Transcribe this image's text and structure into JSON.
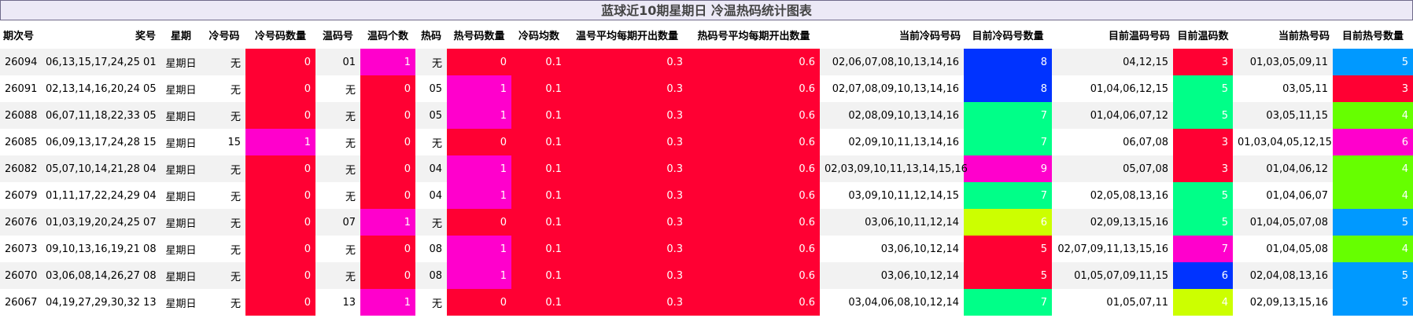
{
  "title": "蓝球近10期星期日 冷温热码统计图表",
  "colors": {
    "red": "#ff0033",
    "magenta": "#ff00cc",
    "blue": "#0033ff",
    "green": "#00ff88",
    "lime": "#ccff00",
    "brightgreen": "#66ff00",
    "skyblue": "#0099ff"
  },
  "headers": [
    "期次号",
    "奖号",
    "星期",
    "冷号码",
    "冷号码数量",
    "温码号",
    "温码个数",
    "热码",
    "热号码数量",
    "冷码均数",
    "温号平均每期开出数量",
    "热码号平均每期开出数量",
    "当前冷码号码",
    "目前冷码号数量",
    "目前温码号码",
    "目前温码数",
    "当前热号码",
    "目前热号数量"
  ],
  "rows": [
    {
      "issue": "26094",
      "balls": "06,13,15,17,24,25 01",
      "weekday": "星期日",
      "cold_no": "无",
      "cold_cnt": "0",
      "cold_cnt_color": "red",
      "warm_no": "01",
      "warm_cnt": "1",
      "warm_cnt_color": "magenta",
      "hot_no": "无",
      "hot_cnt": "0",
      "hot_cnt_color": "red",
      "cold_avg": "0.1",
      "warm_avg": "0.3",
      "hot_avg": "0.6",
      "cur_cold": "02,06,07,08,10,13,14,16",
      "cur_cold_cnt": "8",
      "cur_cold_color": "blue",
      "cur_warm": "04,12,15",
      "cur_warm_cnt": "3",
      "cur_warm_color": "red",
      "cur_hot": "01,03,05,09,11",
      "cur_hot_cnt": "5",
      "cur_hot_color": "skyblue"
    },
    {
      "issue": "26091",
      "balls": "02,13,14,16,20,24 05",
      "weekday": "星期日",
      "cold_no": "无",
      "cold_cnt": "0",
      "cold_cnt_color": "red",
      "warm_no": "无",
      "warm_cnt": "0",
      "warm_cnt_color": "red",
      "hot_no": "05",
      "hot_cnt": "1",
      "hot_cnt_color": "magenta",
      "cold_avg": "0.1",
      "warm_avg": "0.3",
      "hot_avg": "0.6",
      "cur_cold": "02,07,08,09,10,13,14,16",
      "cur_cold_cnt": "8",
      "cur_cold_color": "blue",
      "cur_warm": "01,04,06,12,15",
      "cur_warm_cnt": "5",
      "cur_warm_color": "green",
      "cur_hot": "03,05,11",
      "cur_hot_cnt": "3",
      "cur_hot_color": "red"
    },
    {
      "issue": "26088",
      "balls": "06,07,11,18,22,33 05",
      "weekday": "星期日",
      "cold_no": "无",
      "cold_cnt": "0",
      "cold_cnt_color": "red",
      "warm_no": "无",
      "warm_cnt": "0",
      "warm_cnt_color": "red",
      "hot_no": "05",
      "hot_cnt": "1",
      "hot_cnt_color": "magenta",
      "cold_avg": "0.1",
      "warm_avg": "0.3",
      "hot_avg": "0.6",
      "cur_cold": "02,08,09,10,13,14,16",
      "cur_cold_cnt": "7",
      "cur_cold_color": "green",
      "cur_warm": "01,04,06,07,12",
      "cur_warm_cnt": "5",
      "cur_warm_color": "green",
      "cur_hot": "03,05,11,15",
      "cur_hot_cnt": "4",
      "cur_hot_color": "brightgreen"
    },
    {
      "issue": "26085",
      "balls": "06,09,13,17,24,28 15",
      "weekday": "星期日",
      "cold_no": "15",
      "cold_cnt": "1",
      "cold_cnt_color": "magenta",
      "warm_no": "无",
      "warm_cnt": "0",
      "warm_cnt_color": "red",
      "hot_no": "无",
      "hot_cnt": "0",
      "hot_cnt_color": "red",
      "cold_avg": "0.1",
      "warm_avg": "0.3",
      "hot_avg": "0.6",
      "cur_cold": "02,09,10,11,13,14,16",
      "cur_cold_cnt": "7",
      "cur_cold_color": "green",
      "cur_warm": "06,07,08",
      "cur_warm_cnt": "3",
      "cur_warm_color": "red",
      "cur_hot": "01,03,04,05,12,15",
      "cur_hot_cnt": "6",
      "cur_hot_color": "magenta"
    },
    {
      "issue": "26082",
      "balls": "05,07,10,14,21,28 04",
      "weekday": "星期日",
      "cold_no": "无",
      "cold_cnt": "0",
      "cold_cnt_color": "red",
      "warm_no": "无",
      "warm_cnt": "0",
      "warm_cnt_color": "red",
      "hot_no": "04",
      "hot_cnt": "1",
      "hot_cnt_color": "magenta",
      "cold_avg": "0.1",
      "warm_avg": "0.3",
      "hot_avg": "0.6",
      "cur_cold": "02,03,09,10,11,13,14,15,16",
      "cur_cold_cnt": "9",
      "cur_cold_color": "magenta",
      "cur_warm": "05,07,08",
      "cur_warm_cnt": "3",
      "cur_warm_color": "red",
      "cur_hot": "01,04,06,12",
      "cur_hot_cnt": "4",
      "cur_hot_color": "brightgreen"
    },
    {
      "issue": "26079",
      "balls": "01,11,17,22,24,29 04",
      "weekday": "星期日",
      "cold_no": "无",
      "cold_cnt": "0",
      "cold_cnt_color": "red",
      "warm_no": "无",
      "warm_cnt": "0",
      "warm_cnt_color": "red",
      "hot_no": "04",
      "hot_cnt": "1",
      "hot_cnt_color": "magenta",
      "cold_avg": "0.1",
      "warm_avg": "0.3",
      "hot_avg": "0.6",
      "cur_cold": "03,09,10,11,12,14,15",
      "cur_cold_cnt": "7",
      "cur_cold_color": "green",
      "cur_warm": "02,05,08,13,16",
      "cur_warm_cnt": "5",
      "cur_warm_color": "green",
      "cur_hot": "01,04,06,07",
      "cur_hot_cnt": "4",
      "cur_hot_color": "brightgreen"
    },
    {
      "issue": "26076",
      "balls": "01,03,19,20,24,25 07",
      "weekday": "星期日",
      "cold_no": "无",
      "cold_cnt": "0",
      "cold_cnt_color": "red",
      "warm_no": "07",
      "warm_cnt": "1",
      "warm_cnt_color": "magenta",
      "hot_no": "无",
      "hot_cnt": "0",
      "hot_cnt_color": "red",
      "cold_avg": "0.1",
      "warm_avg": "0.3",
      "hot_avg": "0.6",
      "cur_cold": "03,06,10,11,12,14",
      "cur_cold_cnt": "6",
      "cur_cold_color": "lime",
      "cur_warm": "02,09,13,15,16",
      "cur_warm_cnt": "5",
      "cur_warm_color": "green",
      "cur_hot": "01,04,05,07,08",
      "cur_hot_cnt": "5",
      "cur_hot_color": "skyblue"
    },
    {
      "issue": "26073",
      "balls": "09,10,13,16,19,21 08",
      "weekday": "星期日",
      "cold_no": "无",
      "cold_cnt": "0",
      "cold_cnt_color": "red",
      "warm_no": "无",
      "warm_cnt": "0",
      "warm_cnt_color": "red",
      "hot_no": "08",
      "hot_cnt": "1",
      "hot_cnt_color": "magenta",
      "cold_avg": "0.1",
      "warm_avg": "0.3",
      "hot_avg": "0.6",
      "cur_cold": "03,06,10,12,14",
      "cur_cold_cnt": "5",
      "cur_cold_color": "red",
      "cur_warm": "02,07,09,11,13,15,16",
      "cur_warm_cnt": "7",
      "cur_warm_color": "magenta",
      "cur_hot": "01,04,05,08",
      "cur_hot_cnt": "4",
      "cur_hot_color": "brightgreen"
    },
    {
      "issue": "26070",
      "balls": "03,06,08,14,26,27 08",
      "weekday": "星期日",
      "cold_no": "无",
      "cold_cnt": "0",
      "cold_cnt_color": "red",
      "warm_no": "无",
      "warm_cnt": "0",
      "warm_cnt_color": "red",
      "hot_no": "08",
      "hot_cnt": "1",
      "hot_cnt_color": "magenta",
      "cold_avg": "0.1",
      "warm_avg": "0.3",
      "hot_avg": "0.6",
      "cur_cold": "03,06,10,12,14",
      "cur_cold_cnt": "5",
      "cur_cold_color": "red",
      "cur_warm": "01,05,07,09,11,15",
      "cur_warm_cnt": "6",
      "cur_warm_color": "blue",
      "cur_hot": "02,04,08,13,16",
      "cur_hot_cnt": "5",
      "cur_hot_color": "skyblue"
    },
    {
      "issue": "26067",
      "balls": "04,19,27,29,30,32 13",
      "weekday": "星期日",
      "cold_no": "无",
      "cold_cnt": "0",
      "cold_cnt_color": "red",
      "warm_no": "13",
      "warm_cnt": "1",
      "warm_cnt_color": "magenta",
      "hot_no": "无",
      "hot_cnt": "0",
      "hot_cnt_color": "red",
      "cold_avg": "0.1",
      "warm_avg": "0.3",
      "hot_avg": "0.6",
      "cur_cold": "03,04,06,08,10,12,14",
      "cur_cold_cnt": "7",
      "cur_cold_color": "green",
      "cur_warm": "01,05,07,11",
      "cur_warm_cnt": "4",
      "cur_warm_color": "lime",
      "cur_hot": "02,09,13,15,16",
      "cur_hot_cnt": "5",
      "cur_hot_color": "skyblue"
    }
  ]
}
